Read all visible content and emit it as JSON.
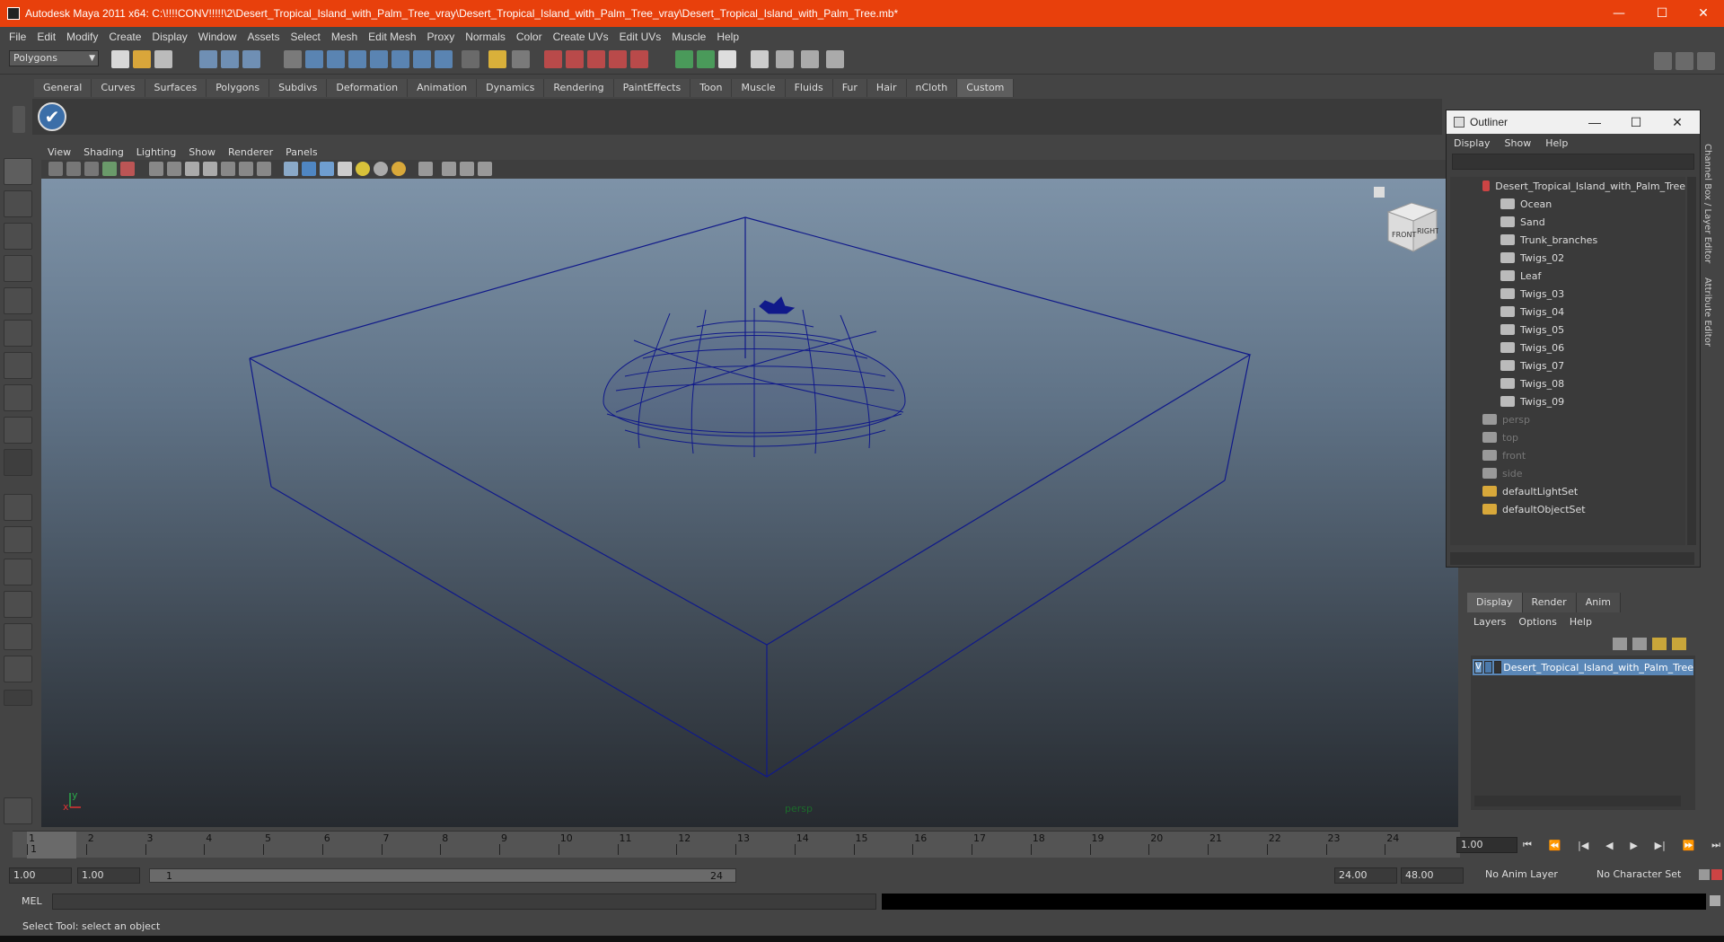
{
  "window": {
    "title": "Autodesk Maya 2011 x64: C:\\!!!!CONV!!!!!\\2\\Desert_Tropical_Island_with_Palm_Tree_vray\\Desert_Tropical_Island_with_Palm_Tree_vray\\Desert_Tropical_Island_with_Palm_Tree.mb*",
    "minimize": "—",
    "maximize": "☐",
    "close": "✕"
  },
  "menubar": [
    "File",
    "Edit",
    "Modify",
    "Create",
    "Display",
    "Window",
    "Assets",
    "Select",
    "Mesh",
    "Edit Mesh",
    "Proxy",
    "Normals",
    "Color",
    "Create UVs",
    "Edit UVs",
    "Muscle",
    "Help"
  ],
  "mode_menu": {
    "value": "Polygons"
  },
  "shelf_tabs": [
    "General",
    "Curves",
    "Surfaces",
    "Polygons",
    "Subdivs",
    "Deformation",
    "Animation",
    "Dynamics",
    "Rendering",
    "PaintEffects",
    "Toon",
    "Muscle",
    "Fluids",
    "Fur",
    "Hair",
    "nCloth",
    "Custom"
  ],
  "shelf_active": "Custom",
  "shelf_button_glyph": "✔",
  "panel_menu": [
    "View",
    "Shading",
    "Lighting",
    "Show",
    "Renderer",
    "Panels"
  ],
  "viewport": {
    "camera_label": "persp",
    "viewcube_front": "FRONT",
    "viewcube_right": "RIGHT",
    "axis_x": "x",
    "axis_y": "y"
  },
  "outliner": {
    "title": "Outliner",
    "menu": [
      "Display",
      "Show",
      "Help"
    ],
    "items": [
      {
        "label": "Desert_Tropical_Island_with_Palm_Tree",
        "type": "group"
      },
      {
        "label": "Ocean",
        "type": "mesh"
      },
      {
        "label": "Sand",
        "type": "mesh"
      },
      {
        "label": "Trunk_branches",
        "type": "mesh"
      },
      {
        "label": "Twigs_02",
        "type": "mesh"
      },
      {
        "label": "Leaf",
        "type": "mesh"
      },
      {
        "label": "Twigs_03",
        "type": "mesh"
      },
      {
        "label": "Twigs_04",
        "type": "mesh"
      },
      {
        "label": "Twigs_05",
        "type": "mesh"
      },
      {
        "label": "Twigs_06",
        "type": "mesh"
      },
      {
        "label": "Twigs_07",
        "type": "mesh"
      },
      {
        "label": "Twigs_08",
        "type": "mesh"
      },
      {
        "label": "Twigs_09",
        "type": "mesh"
      },
      {
        "label": "persp",
        "type": "camera"
      },
      {
        "label": "top",
        "type": "camera"
      },
      {
        "label": "front",
        "type": "camera"
      },
      {
        "label": "side",
        "type": "camera"
      },
      {
        "label": "defaultLightSet",
        "type": "set"
      },
      {
        "label": "defaultObjectSet",
        "type": "set"
      }
    ]
  },
  "side_tabs": [
    "Channel Box / Layer Editor",
    "Attribute Editor"
  ],
  "layer_editor": {
    "tabs": [
      "Display",
      "Render",
      "Anim"
    ],
    "active_tab": "Display",
    "menu": [
      "Layers",
      "Options",
      "Help"
    ],
    "layer": {
      "visible": "V",
      "name": "Desert_Tropical_Island_with_Palm_Tree"
    }
  },
  "timeline": {
    "frames": [
      "1",
      "2",
      "3",
      "4",
      "5",
      "6",
      "7",
      "8",
      "9",
      "10",
      "11",
      "12",
      "13",
      "14",
      "15",
      "16",
      "17",
      "18",
      "19",
      "20",
      "21",
      "22",
      "23",
      "24"
    ],
    "current_frame_marker": "1",
    "current_frame": "1.00"
  },
  "playback_buttons": [
    "⏮",
    "⏪",
    "|◀",
    "◀",
    "▶",
    "▶|",
    "⏩",
    "⏭"
  ],
  "range": {
    "start": "1.00",
    "playback_start": "1.00",
    "slider_min": "1",
    "slider_max": "24",
    "playback_end": "24.00",
    "end": "48.00",
    "anim_layer": "No Anim Layer",
    "character_set": "No Character Set"
  },
  "command_line": {
    "label": "MEL",
    "value": ""
  },
  "help_line": "Select Tool: select an object",
  "colors": {
    "titlebar": "#e8400c",
    "wireframe": "#10198a",
    "layer_highlight": "#5b88b8"
  }
}
